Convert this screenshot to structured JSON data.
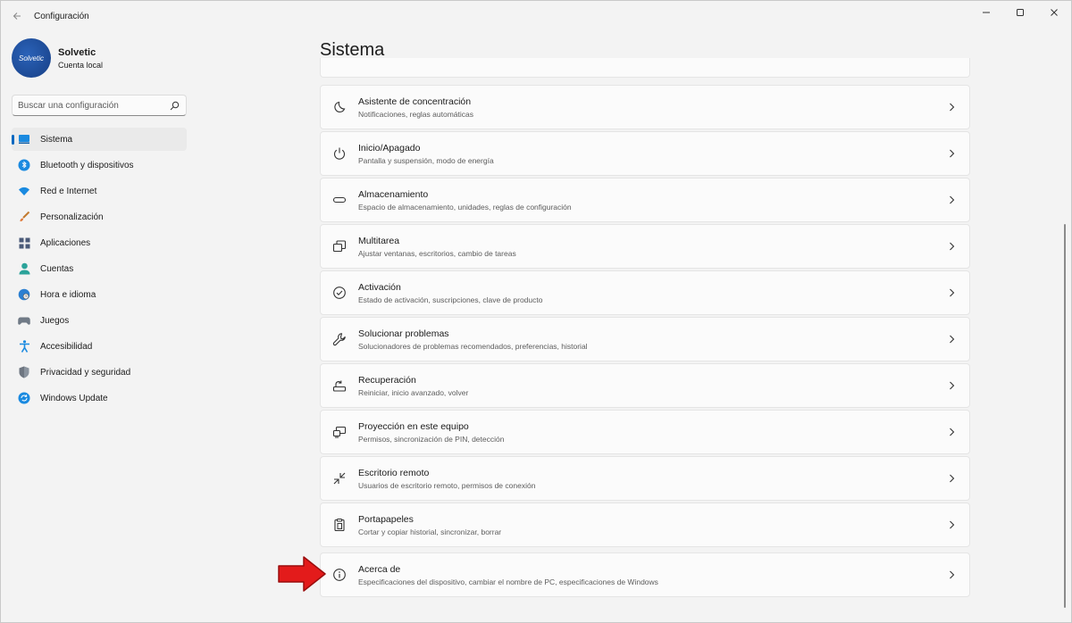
{
  "window": {
    "title": "Configuración"
  },
  "profile": {
    "name": "Solvetic",
    "account_type": "Cuenta local",
    "avatar_text": "Solvetic"
  },
  "search": {
    "placeholder": "Buscar una configuración"
  },
  "nav": [
    {
      "label": "Sistema",
      "icon": "monitor-icon",
      "active": true
    },
    {
      "label": "Bluetooth y dispositivos",
      "icon": "bluetooth-icon"
    },
    {
      "label": "Red e Internet",
      "icon": "wifi-icon"
    },
    {
      "label": "Personalización",
      "icon": "brush-icon"
    },
    {
      "label": "Aplicaciones",
      "icon": "apps-icon"
    },
    {
      "label": "Cuentas",
      "icon": "user-icon"
    },
    {
      "label": "Hora e idioma",
      "icon": "globe-clock-icon"
    },
    {
      "label": "Juegos",
      "icon": "gamepad-icon"
    },
    {
      "label": "Accesibilidad",
      "icon": "accessibility-icon"
    },
    {
      "label": "Privacidad y seguridad",
      "icon": "shield-icon"
    },
    {
      "label": "Windows Update",
      "icon": "update-icon"
    }
  ],
  "main": {
    "title": "Sistema",
    "items": [
      {
        "title": "Asistente de concentración",
        "subtitle": "Notificaciones, reglas automáticas",
        "icon": "moon-icon"
      },
      {
        "title": "Inicio/Apagado",
        "subtitle": "Pantalla y suspensión, modo de energía",
        "icon": "power-icon"
      },
      {
        "title": "Almacenamiento",
        "subtitle": "Espacio de almacenamiento, unidades, reglas de configuración",
        "icon": "storage-icon"
      },
      {
        "title": "Multitarea",
        "subtitle": "Ajustar ventanas, escritorios, cambio de tareas",
        "icon": "multitask-icon"
      },
      {
        "title": "Activación",
        "subtitle": "Estado de activación, suscripciones, clave de producto",
        "icon": "check-circle-icon"
      },
      {
        "title": "Solucionar problemas",
        "subtitle": "Solucionadores de problemas recomendados, preferencias, historial",
        "icon": "wrench-icon"
      },
      {
        "title": "Recuperación",
        "subtitle": "Reiniciar, inicio avanzado, volver",
        "icon": "recovery-icon"
      },
      {
        "title": "Proyección en este equipo",
        "subtitle": "Permisos, sincronización de PIN, detección",
        "icon": "projection-icon"
      },
      {
        "title": "Escritorio remoto",
        "subtitle": "Usuarios de escritorio remoto, permisos de conexión",
        "icon": "remote-desktop-icon"
      },
      {
        "title": "Portapapeles",
        "subtitle": "Cortar y copiar historial, sincronizar, borrar",
        "icon": "clipboard-icon"
      },
      {
        "title": "Acerca de",
        "subtitle": "Especificaciones del dispositivo, cambiar el nombre de PC, especificaciones de Windows",
        "icon": "info-icon"
      }
    ]
  },
  "colors": {
    "accent": "#0067c0",
    "arrow": "#e31b1b",
    "background": "#f3f3f3",
    "card": "#fbfbfb"
  }
}
